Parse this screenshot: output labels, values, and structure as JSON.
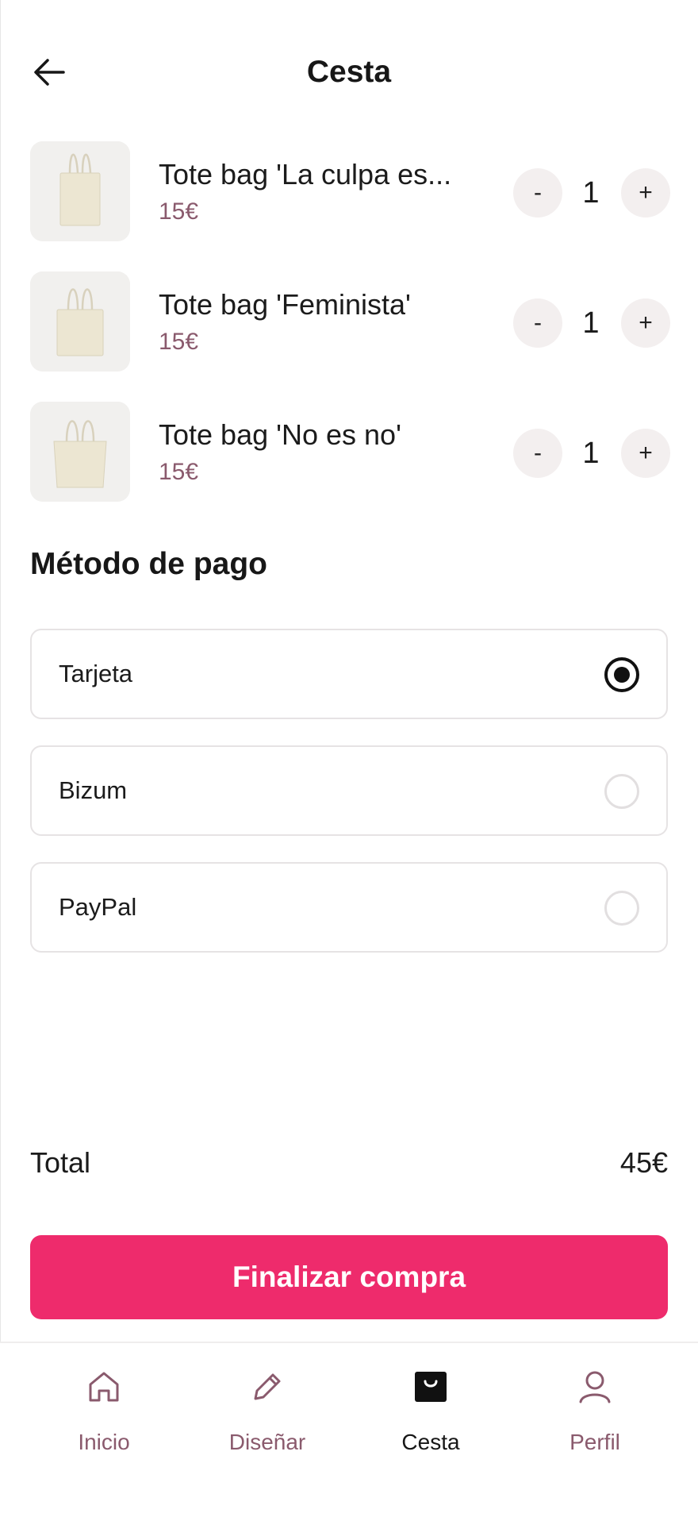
{
  "header": {
    "title": "Cesta",
    "back_icon": "arrow-left-icon"
  },
  "cart": {
    "items": [
      {
        "name": "Tote bag 'La culpa es...",
        "price": "15€",
        "quantity": "1",
        "minus": "-",
        "plus": "+"
      },
      {
        "name": "Tote bag 'Feminista'",
        "price": "15€",
        "quantity": "1",
        "minus": "-",
        "plus": "+"
      },
      {
        "name": "Tote bag 'No es no'",
        "price": "15€",
        "quantity": "1",
        "minus": "-",
        "plus": "+"
      }
    ]
  },
  "payment": {
    "title": "Método de pago",
    "options": [
      {
        "label": "Tarjeta",
        "selected": true
      },
      {
        "label": "Bizum",
        "selected": false
      },
      {
        "label": "PayPal",
        "selected": false
      }
    ]
  },
  "summary": {
    "total_label": "Total",
    "total_value": "45€"
  },
  "checkout": {
    "label": "Finalizar compra",
    "color": "#ee2b6c"
  },
  "nav": {
    "items": [
      {
        "label": "Inicio",
        "icon": "home-icon",
        "active": false
      },
      {
        "label": "Diseñar",
        "icon": "pencil-icon",
        "active": false
      },
      {
        "label": "Cesta",
        "icon": "shopping-bag-icon",
        "active": true
      },
      {
        "label": "Perfil",
        "icon": "user-icon",
        "active": false
      }
    ]
  },
  "colors": {
    "accent": "#ee2b6c",
    "muted": "#8a5a6d"
  }
}
